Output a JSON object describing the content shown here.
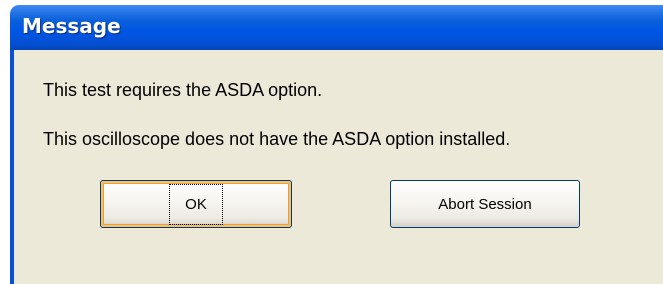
{
  "window": {
    "title": "Message"
  },
  "message": {
    "line1": "This test requires the ASDA option.",
    "line2": "This oscilloscope does not have the ASDA option installed."
  },
  "buttons": {
    "ok_label": "OK",
    "abort_label": "Abort Session"
  },
  "colors": {
    "titlebar": "#0055e5",
    "dialog_face": "#ece9d8",
    "focus_highlight": "#e6a03a"
  }
}
